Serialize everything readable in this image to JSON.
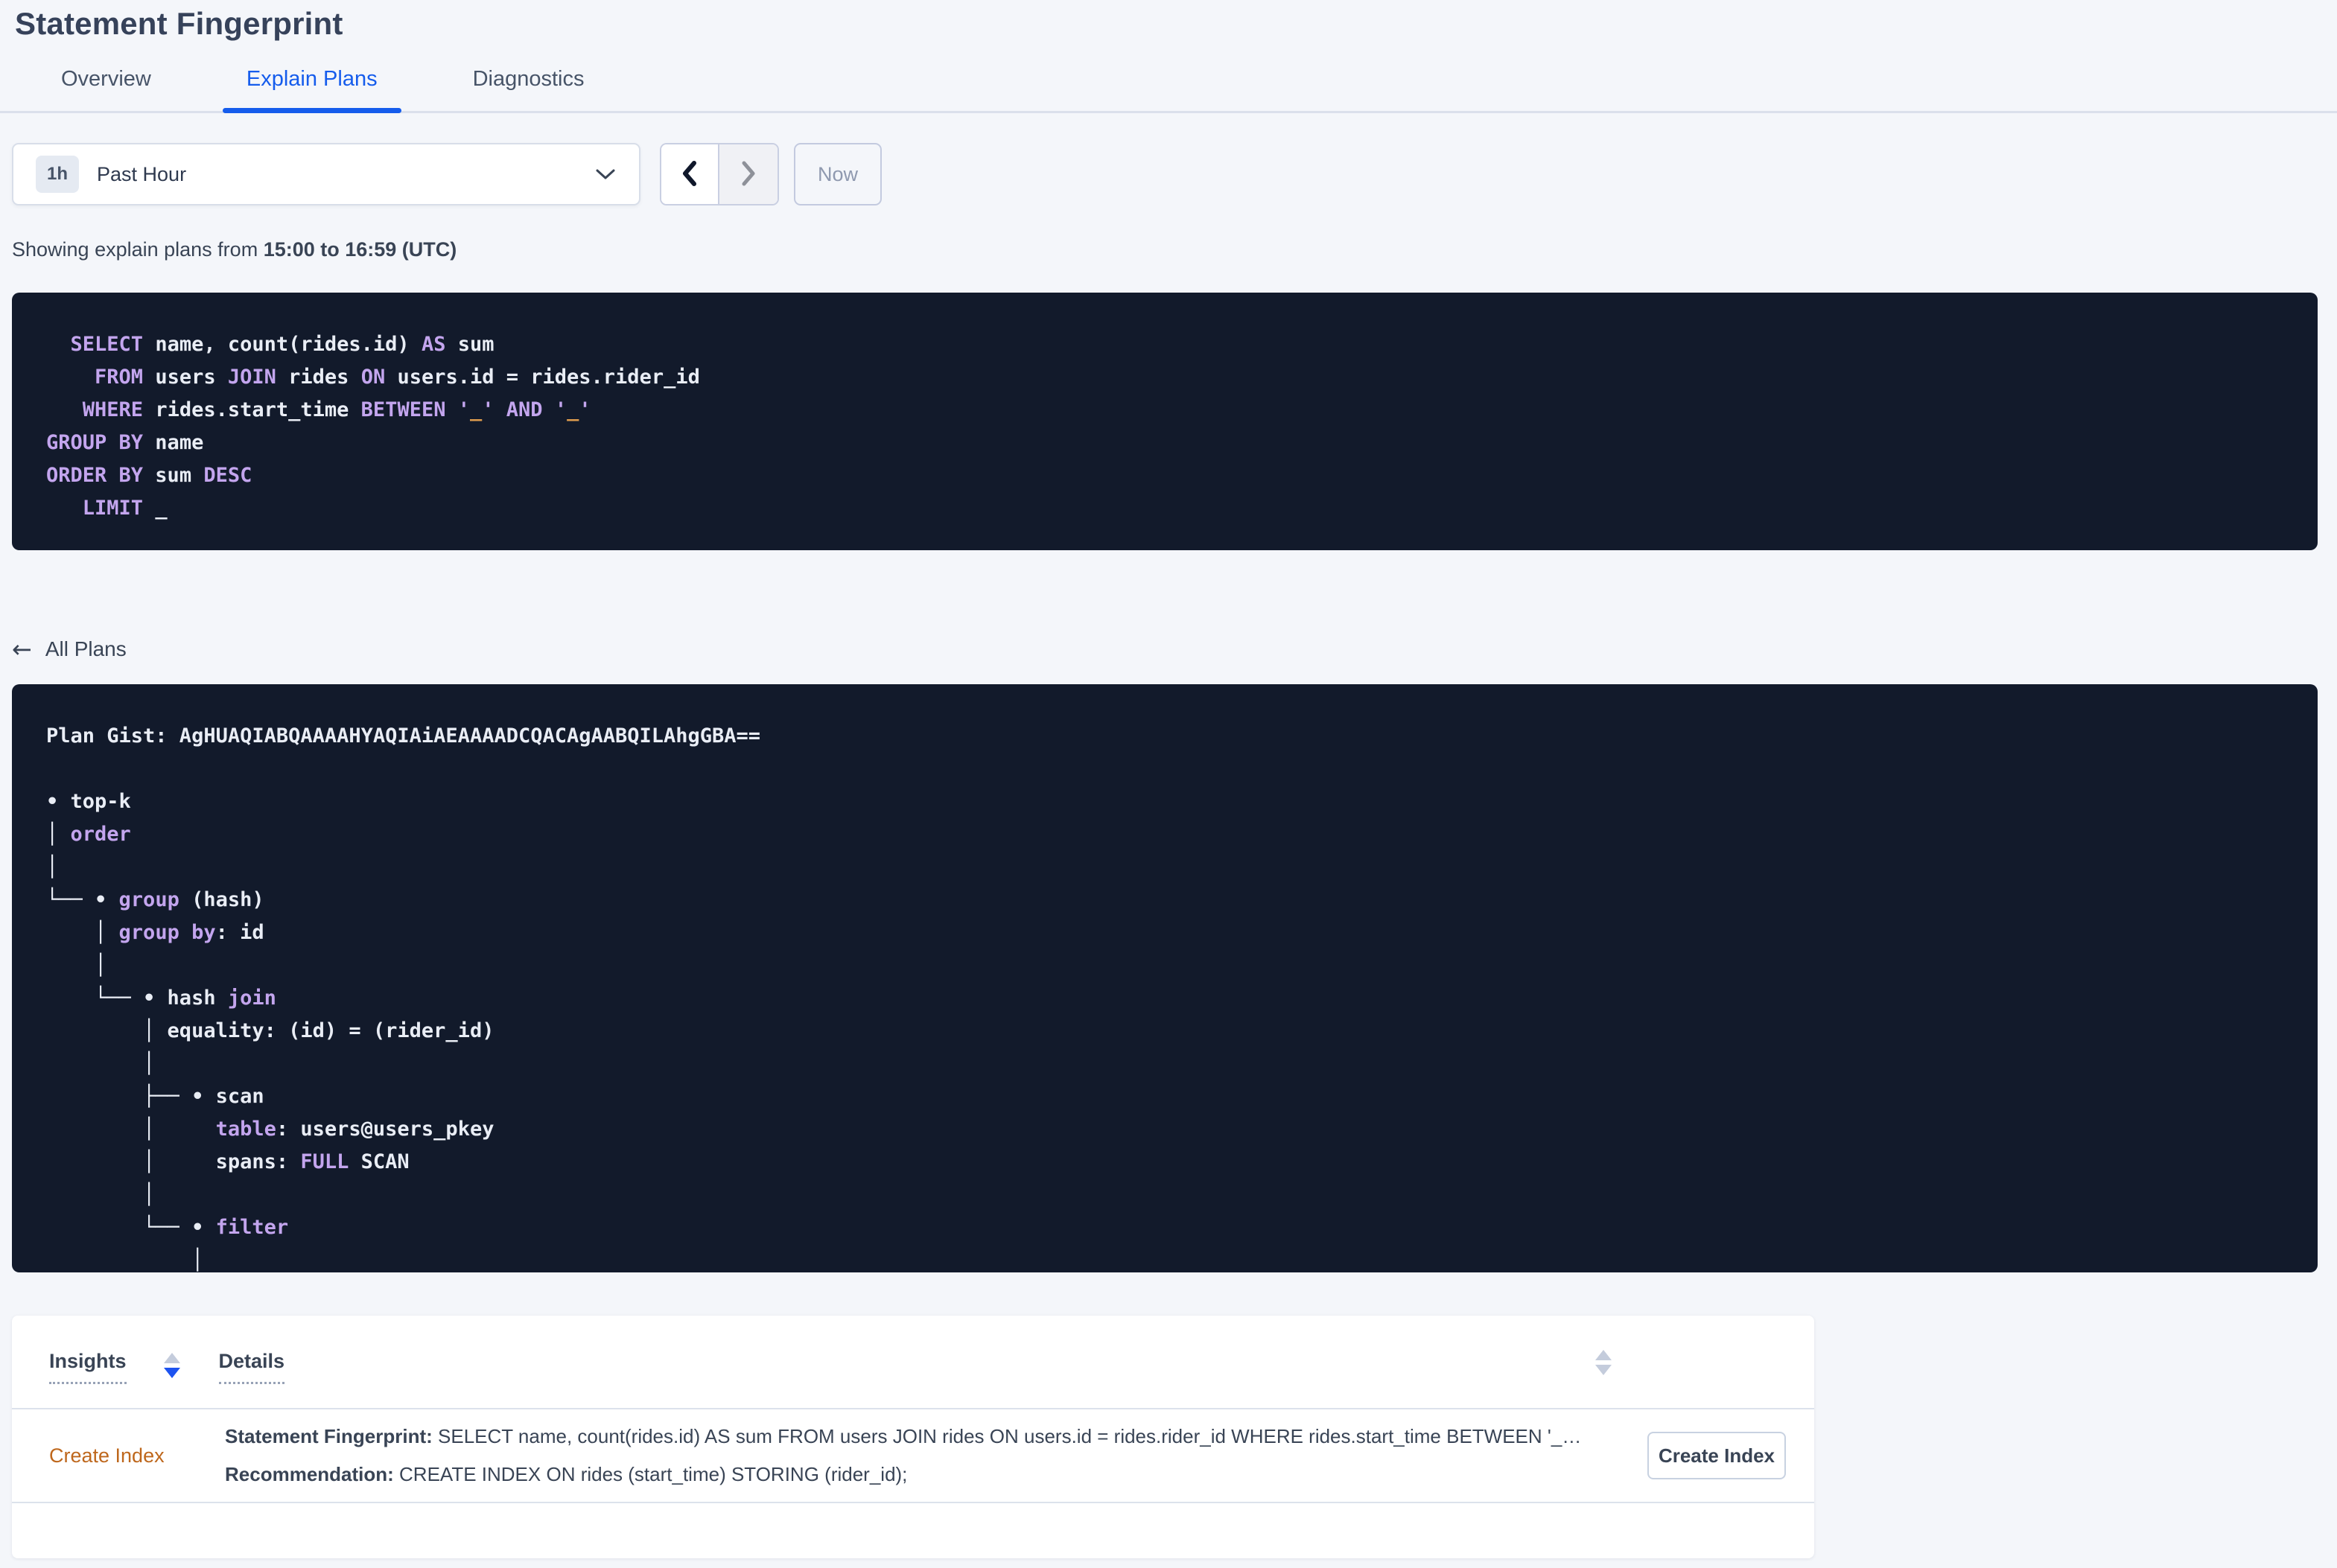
{
  "header": {
    "title": "Statement Fingerprint",
    "tabs": [
      {
        "label": "Overview",
        "active": false
      },
      {
        "label": "Explain Plans",
        "active": true
      },
      {
        "label": "Diagnostics",
        "active": false
      }
    ]
  },
  "time_picker": {
    "badge": "1h",
    "selected": "Past Hour",
    "now_label": "Now"
  },
  "time_range": {
    "prefix": "Showing explain plans from ",
    "range": "15:00 to 16:59 (UTC)"
  },
  "sql_block": {
    "lines": [
      [
        {
          "c": "w",
          "t": "  "
        },
        {
          "c": "kw",
          "t": "SELECT"
        },
        {
          "c": "w",
          "t": " name, count(rides.id) "
        },
        {
          "c": "kw",
          "t": "AS"
        },
        {
          "c": "w",
          "t": " sum"
        }
      ],
      [
        {
          "c": "w",
          "t": "    "
        },
        {
          "c": "kw",
          "t": "FROM"
        },
        {
          "c": "w",
          "t": " users "
        },
        {
          "c": "kw",
          "t": "JOIN"
        },
        {
          "c": "w",
          "t": " rides "
        },
        {
          "c": "kw",
          "t": "ON"
        },
        {
          "c": "w",
          "t": " users.id = rides.rider_id"
        }
      ],
      [
        {
          "c": "w",
          "t": "   "
        },
        {
          "c": "kw",
          "t": "WHERE"
        },
        {
          "c": "w",
          "t": " rides.start_time "
        },
        {
          "c": "kw",
          "t": "BETWEEN"
        },
        {
          "c": "w",
          "t": " "
        },
        {
          "c": "kw",
          "t": "'"
        },
        {
          "c": "or",
          "t": "_"
        },
        {
          "c": "kw",
          "t": "'"
        },
        {
          "c": "w",
          "t": " "
        },
        {
          "c": "kw",
          "t": "AND"
        },
        {
          "c": "w",
          "t": " "
        },
        {
          "c": "kw",
          "t": "'"
        },
        {
          "c": "or",
          "t": "_"
        },
        {
          "c": "kw",
          "t": "'"
        }
      ],
      [
        {
          "c": "kw",
          "t": "GROUP BY"
        },
        {
          "c": "w",
          "t": " name"
        }
      ],
      [
        {
          "c": "kw",
          "t": "ORDER BY"
        },
        {
          "c": "w",
          "t": " sum "
        },
        {
          "c": "kw",
          "t": "DESC"
        }
      ],
      [
        {
          "c": "w",
          "t": "   "
        },
        {
          "c": "kw",
          "t": "LIMIT"
        },
        {
          "c": "w",
          "t": " _"
        }
      ]
    ]
  },
  "plan": {
    "back_label": "All Plans",
    "lines": [
      [
        {
          "c": "w",
          "t": "Plan Gist: AgHUAQIABQAAAAHYAQIAiAEAAAADCQACAgAABQILAhgGBA=="
        }
      ],
      [],
      [
        {
          "c": "w",
          "t": "• top-k"
        }
      ],
      [
        {
          "c": "w",
          "t": "│ "
        },
        {
          "c": "kw",
          "t": "order"
        }
      ],
      [
        {
          "c": "w",
          "t": "│"
        }
      ],
      [
        {
          "c": "w",
          "t": "└── • "
        },
        {
          "c": "kw",
          "t": "group"
        },
        {
          "c": "w",
          "t": " (hash)"
        }
      ],
      [
        {
          "c": "w",
          "t": "    │ "
        },
        {
          "c": "kw",
          "t": "group by"
        },
        {
          "c": "w",
          "t": ": id"
        }
      ],
      [
        {
          "c": "w",
          "t": "    │"
        }
      ],
      [
        {
          "c": "w",
          "t": "    └── • hash "
        },
        {
          "c": "kw",
          "t": "join"
        }
      ],
      [
        {
          "c": "w",
          "t": "        │ equality: (id) = (rider_id)"
        }
      ],
      [
        {
          "c": "w",
          "t": "        │"
        }
      ],
      [
        {
          "c": "w",
          "t": "        ├── • scan"
        }
      ],
      [
        {
          "c": "w",
          "t": "        │     "
        },
        {
          "c": "kw",
          "t": "table"
        },
        {
          "c": "w",
          "t": ": users@users_pkey"
        }
      ],
      [
        {
          "c": "w",
          "t": "        │     spans: "
        },
        {
          "c": "kw",
          "t": "FULL"
        },
        {
          "c": "w",
          "t": " SCAN"
        }
      ],
      [
        {
          "c": "w",
          "t": "        │"
        }
      ],
      [
        {
          "c": "w",
          "t": "        └── • "
        },
        {
          "c": "kw",
          "t": "filter"
        }
      ],
      [
        {
          "c": "w",
          "t": "            │"
        }
      ]
    ]
  },
  "insights_table": {
    "columns": [
      {
        "label": "Insights"
      },
      {
        "label": "Details"
      }
    ],
    "rows": [
      {
        "insight": "Create Index",
        "fingerprint_label": "Statement Fingerprint: ",
        "fingerprint_text": "SELECT name, count(rides.id) AS sum FROM users JOIN rides ON users.id = rides.rider_id WHERE rides.start_time BETWEEN '_…",
        "recommendation_label": "Recommendation: ",
        "recommendation_text": "CREATE INDEX ON rides (start_time) STORING (rider_id);",
        "action_label": "Create Index"
      }
    ]
  },
  "colors": {
    "accent_blue": "#155CEC",
    "sort_active_blue": "#1D53F0",
    "insight_orange": "#BE671C",
    "code_keyword_purple": "#C3A5EE",
    "code_literal_orange": "#DE9C4E",
    "code_background": "#121A2B",
    "page_background": "#F4F6FA"
  }
}
